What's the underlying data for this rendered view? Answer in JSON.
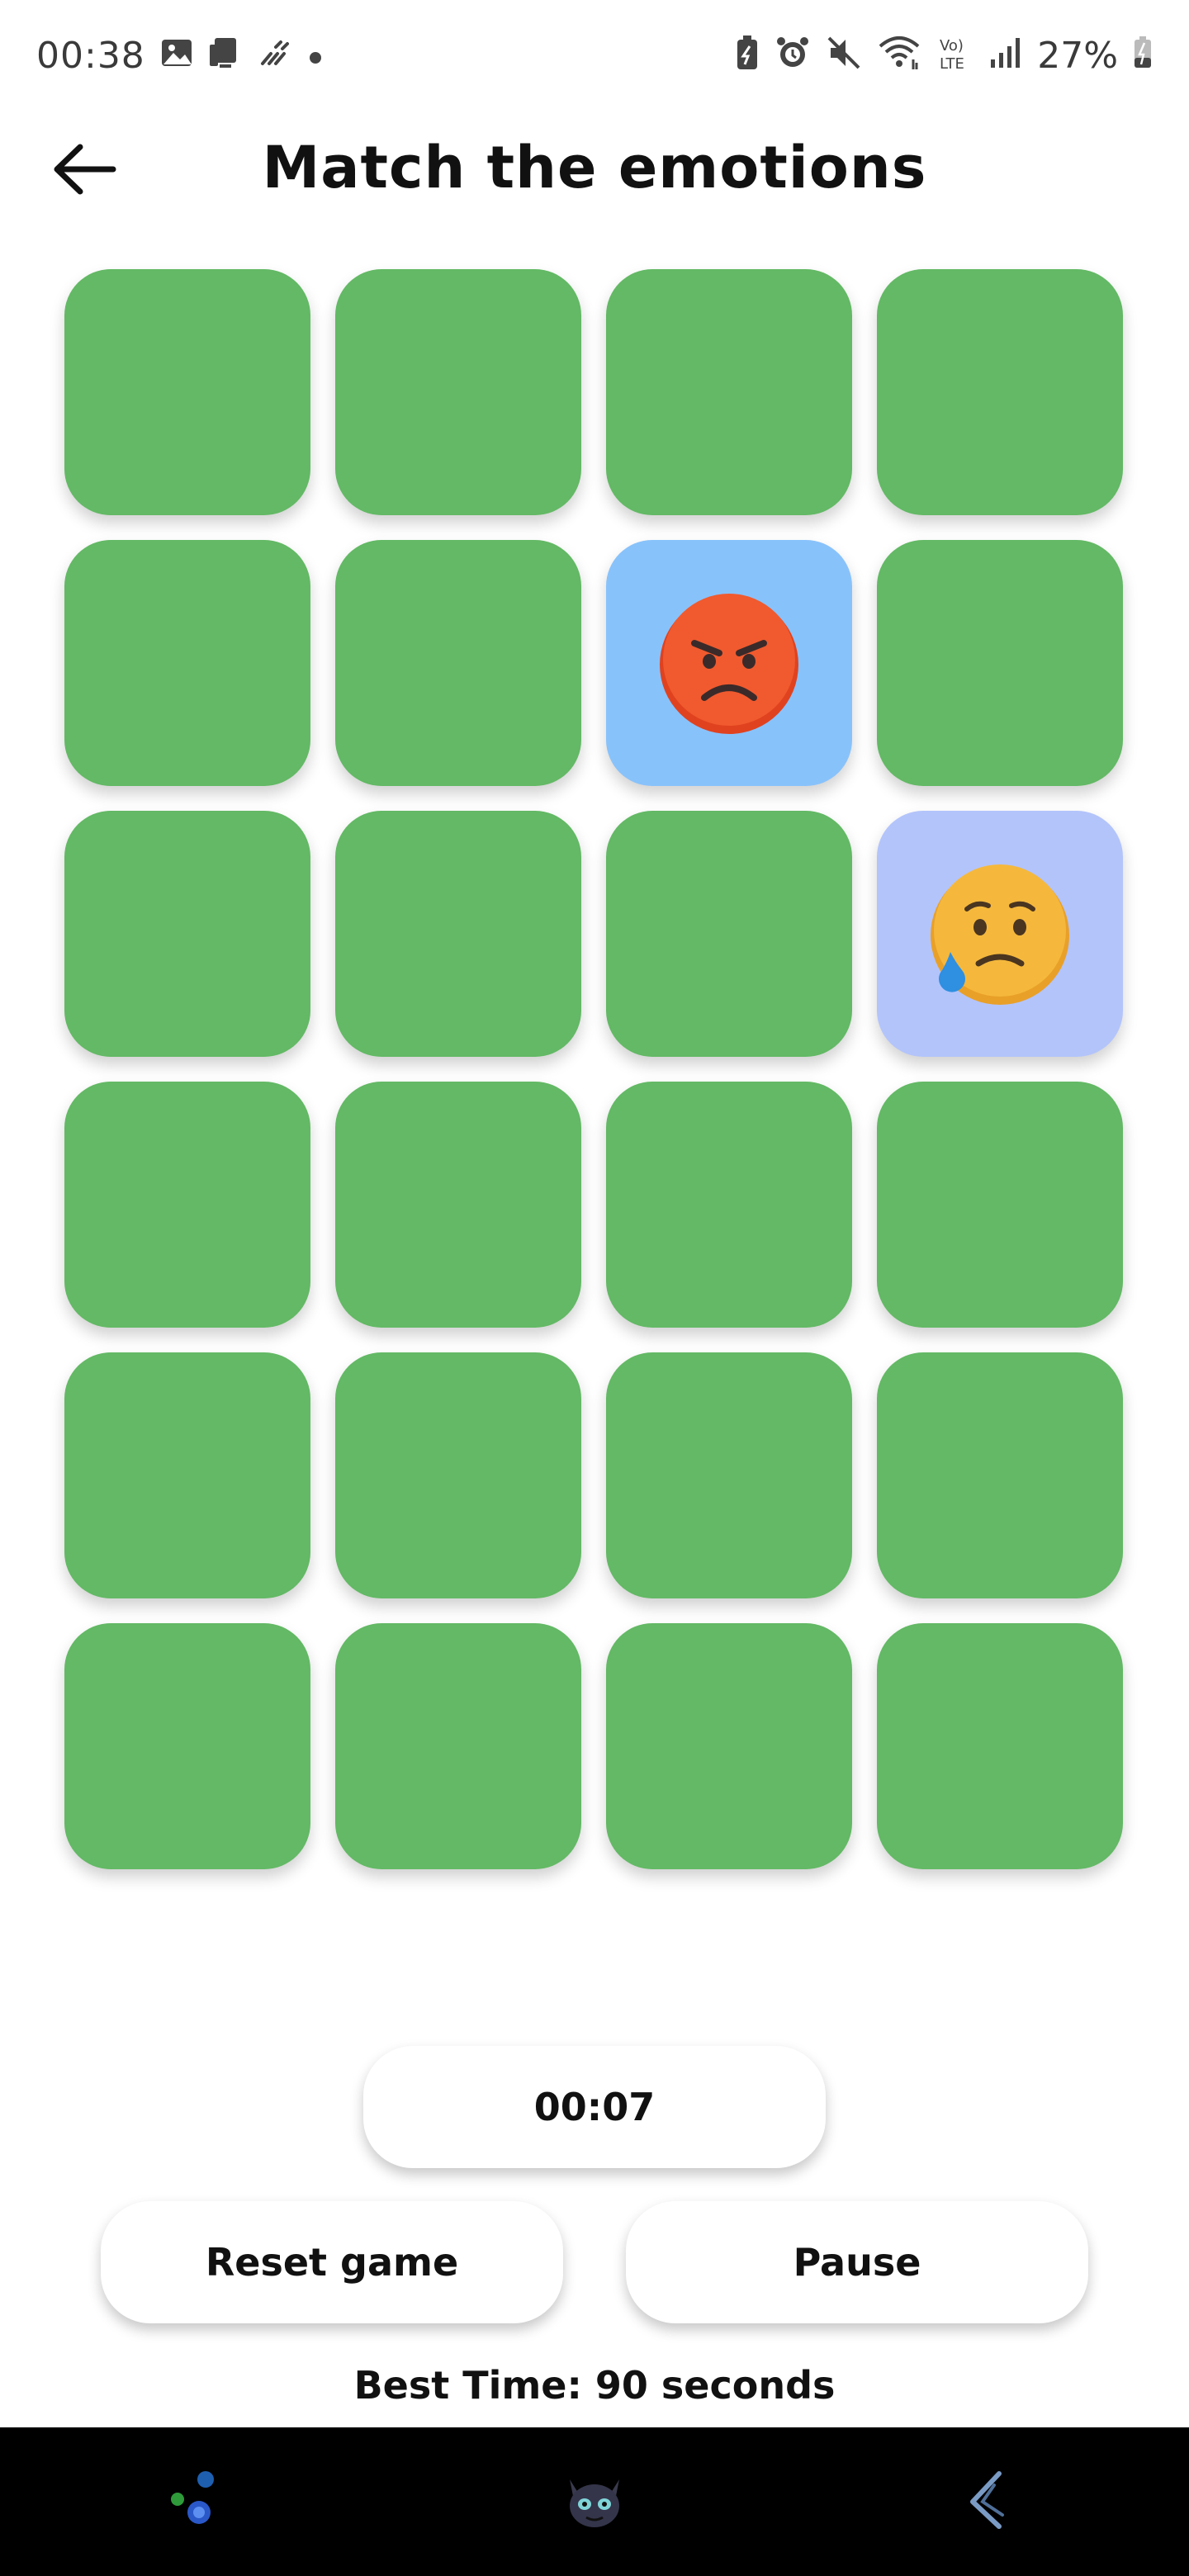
{
  "status_bar": {
    "time": "00:38",
    "battery": "27%",
    "left_icons": [
      "gallery-icon",
      "screen-cast-icon",
      "weather-icon",
      "dot-icon"
    ],
    "right_icons": [
      "battery-saver-icon",
      "alarm-icon",
      "mute-icon",
      "wifi-icon",
      "volte-icon",
      "signal-icon"
    ]
  },
  "header": {
    "title": "Match the emotions",
    "back_icon": "arrow-left-icon"
  },
  "board": {
    "rows": 6,
    "cols": 4,
    "card_back_color": "#63b965",
    "revealed": [
      {
        "row": 2,
        "col": 3,
        "emoji": "angry-face",
        "bg": "#88c2fb"
      },
      {
        "row": 3,
        "col": 4,
        "emoji": "crying-face",
        "bg": "#b3c4fb"
      }
    ]
  },
  "timer": "00:07",
  "buttons": {
    "reset_label": "Reset game",
    "pause_label": "Pause"
  },
  "best_time": "Best Time: 90 seconds",
  "nav_bar": {
    "items": [
      "app-drawer-icon",
      "dragon-avatar-icon",
      "back-gesture-icon"
    ]
  }
}
